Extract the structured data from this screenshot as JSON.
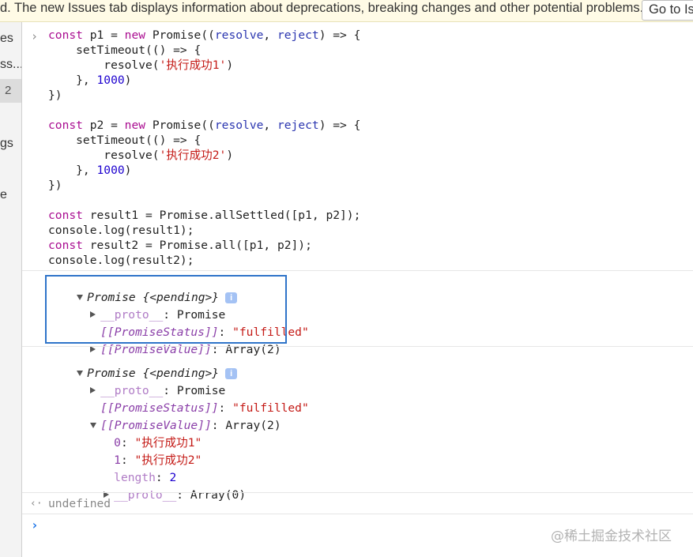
{
  "banner": {
    "text": "d. The new Issues tab displays information about deprecations, breaking changes and other potential problems.",
    "button_label": "Go to Is"
  },
  "sidebar": {
    "items": [
      "es",
      "ss...",
      "gs",
      "e"
    ],
    "selected_count": "2"
  },
  "code": {
    "prompt_symbol": "›",
    "lines": [
      [
        {
          "t": "const ",
          "c": "kw"
        },
        {
          "t": "p1 = ",
          "c": "fn"
        },
        {
          "t": "new ",
          "c": "kw"
        },
        {
          "t": "Promise((",
          "c": "fn"
        },
        {
          "t": "resolve",
          "c": "kw2"
        },
        {
          "t": ", ",
          "c": "fn"
        },
        {
          "t": "reject",
          "c": "kw2"
        },
        {
          "t": ") => {",
          "c": "fn"
        }
      ],
      [
        {
          "t": "    setTimeout(() => {",
          "c": "fn"
        }
      ],
      [
        {
          "t": "        resolve(",
          "c": "fn"
        },
        {
          "t": "'执行成功1'",
          "c": "str"
        },
        {
          "t": ")",
          "c": "fn"
        }
      ],
      [
        {
          "t": "    }, ",
          "c": "fn"
        },
        {
          "t": "1000",
          "c": "num"
        },
        {
          "t": ")",
          "c": "fn"
        }
      ],
      [
        {
          "t": "})",
          "c": "fn"
        }
      ],
      [],
      [
        {
          "t": "const ",
          "c": "kw"
        },
        {
          "t": "p2 = ",
          "c": "fn"
        },
        {
          "t": "new ",
          "c": "kw"
        },
        {
          "t": "Promise((",
          "c": "fn"
        },
        {
          "t": "resolve",
          "c": "kw2"
        },
        {
          "t": ", ",
          "c": "fn"
        },
        {
          "t": "reject",
          "c": "kw2"
        },
        {
          "t": ") => {",
          "c": "fn"
        }
      ],
      [
        {
          "t": "    setTimeout(() => {",
          "c": "fn"
        }
      ],
      [
        {
          "t": "        resolve(",
          "c": "fn"
        },
        {
          "t": "'执行成功2'",
          "c": "str"
        },
        {
          "t": ")",
          "c": "fn"
        }
      ],
      [
        {
          "t": "    }, ",
          "c": "fn"
        },
        {
          "t": "1000",
          "c": "num"
        },
        {
          "t": ")",
          "c": "fn"
        }
      ],
      [
        {
          "t": "})",
          "c": "fn"
        }
      ],
      [],
      [
        {
          "t": "const ",
          "c": "kw"
        },
        {
          "t": "result1 = Promise.allSettled([p1, p2]);",
          "c": "fn"
        }
      ],
      [
        {
          "t": "console.log(result1);",
          "c": "fn"
        }
      ],
      [
        {
          "t": "const ",
          "c": "kw"
        },
        {
          "t": "result2 = Promise.all([p1, p2]);",
          "c": "fn"
        }
      ],
      [
        {
          "t": "console.log(result2);",
          "c": "fn"
        }
      ]
    ]
  },
  "output1": {
    "header": "Promise {<pending>}",
    "info": "i",
    "proto_key": "__proto__",
    "proto_val": "Promise",
    "status_key": "[[PromiseStatus]]",
    "status_val": "\"fulfilled\"",
    "value_key": "[[PromiseValue]]",
    "value_val": "Array(2)"
  },
  "output2": {
    "header": "Promise {<pending>}",
    "info": "i",
    "proto_key": "__proto__",
    "proto_val": "Promise",
    "status_key": "[[PromiseStatus]]",
    "status_val": "\"fulfilled\"",
    "value_key": "[[PromiseValue]]",
    "value_val": "Array(2)",
    "item0_key": "0",
    "item0_val": "\"执行成功1\"",
    "item1_key": "1",
    "item1_val": "\"执行成功2\"",
    "length_key": "length",
    "length_val": "2",
    "arr_proto_key": "__proto__",
    "arr_proto_val": "Array(0)"
  },
  "result": {
    "return_symbol": "‹·",
    "value": "undefined"
  },
  "input": {
    "prompt_symbol": "›"
  },
  "watermark": "@稀土掘金技术社区",
  "colors": {
    "highlight": "#2f74c9",
    "keyword": "#aa0d91",
    "string": "#c41a16",
    "number": "#1c00cf"
  }
}
